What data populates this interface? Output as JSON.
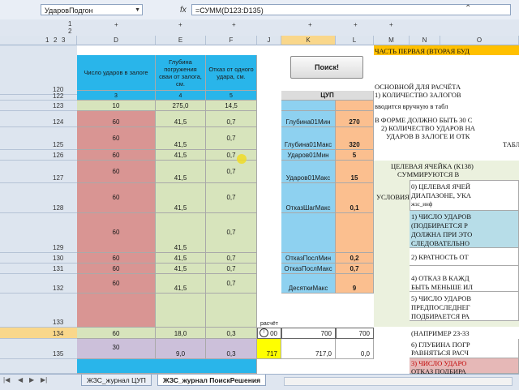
{
  "formula_bar": {
    "name_box": "УдаровПодгон",
    "fx": "fx",
    "formula": "=СУММ(D123:D135)"
  },
  "outline": {
    "levels": [
      "1",
      "2"
    ],
    "markers": [
      "+",
      "+",
      "+",
      "+",
      "+",
      "+"
    ],
    "left_row": [
      "1",
      "2",
      "3"
    ]
  },
  "columns": [
    "D",
    "E",
    "F",
    "J",
    "K",
    "L",
    "M",
    "N",
    "O"
  ],
  "rows": {
    "r120": "120",
    "r121": "121",
    "r122": "122",
    "r123": "123",
    "r124": "124",
    "r125": "125",
    "r126": "126",
    "r127": "127",
    "r128": "128",
    "r129": "129",
    "r130": "130",
    "r131": "131",
    "r132": "132",
    "r133": "133",
    "r134": "134",
    "r135": "135"
  },
  "headers": {
    "d": "Число ударов в залоге",
    "e": "Глубина погружения сваи от залога, см.",
    "f": "Отказ от одного удара, см.",
    "d_num": "3",
    "e_num": "4",
    "f_num": "5"
  },
  "search_button": "Поиск!",
  "cup_title": "ЦУП",
  "data": {
    "r123": {
      "d": "10",
      "e": "275,0",
      "f": "14,5"
    },
    "r124": {
      "d": "60",
      "e": "41,5",
      "f": "0,7"
    },
    "r125": {
      "d": "60",
      "e": "41,5",
      "f": "0,7"
    },
    "r126": {
      "d": "60",
      "e": "41,5",
      "f": "0,7"
    },
    "r127": {
      "d": "60",
      "e": "41,5",
      "f": "0,7"
    },
    "r128": {
      "d": "60",
      "e": "41,5",
      "f": "0,7"
    },
    "r129": {
      "d": "60",
      "e": "41,5",
      "f": "0,7"
    },
    "r130": {
      "d": "60",
      "e": "41,5",
      "f": "0,7"
    },
    "r131": {
      "d": "60",
      "e": "41,5",
      "f": "0,7"
    },
    "r132": {
      "d": "60",
      "e": "41,5",
      "f": "0,7"
    },
    "r134": {
      "d": "60",
      "e": "18,0",
      "f": "0,3"
    },
    "r135": {
      "d": "30",
      "e": "9,0",
      "f": "0,3"
    }
  },
  "params": [
    {
      "label": "Глубина01Мин",
      "value": "270"
    },
    {
      "label": "Глубина01Макс",
      "value": "320"
    },
    {
      "label": "Ударов01Мин",
      "value": "5"
    },
    {
      "label": "Ударов01Макс",
      "value": "15"
    },
    {
      "label": "ОтказШагМакс",
      "value": "0,1"
    },
    {
      "label": "ОтказПослМин",
      "value": "0,2"
    },
    {
      "label": "ОтказПослМакс",
      "value": "0,7"
    },
    {
      "label": "ДесяткиМакс",
      "value": "9"
    }
  ],
  "calc": {
    "raschet": "расчёт",
    "j134": "00",
    "k134": "700",
    "l134": "700",
    "j135": "717",
    "k135": "717,0",
    "l135": "0,0"
  },
  "notes": {
    "part": "ЧАСТЬ ПЕРВАЯ (ВТОРАЯ БУД",
    "basis": "ОСНОВНОЙ ДЛЯ РАСЧЁТА",
    "item1": "1) КОЛИЧЕСТВО ЗАЛОГОВ",
    "manual": "вводится вручную в табл",
    "form": "В ФОРМЕ ДОЛЖНО БЫТЬ 30 С",
    "item2": "2) КОЛИЧЕСТВО УДАРОВ НА",
    "item2b": "УДАРОВ В ЗАЛОГЕ И ОТК",
    "item2c": "ТАБЛ",
    "target": "ЦЕЛЕВАЯ ЯЧЕЙКА (К138)",
    "sum": "СУММИРУЮТСЯ В",
    "conditions": "УСЛОВИЯ",
    "c0a": "0) ЦЕЛЕВАЯ ЯЧЕЙ",
    "c0b": "ДИАПАЗОНЕ, УКА",
    "c0c": "жзс_инф",
    "c1a": "1) ЧИСЛО УДАРОВ",
    "c1b": "(ПОДБИРАЕТСЯ Р",
    "c1c": "ДОЛЖНА ПРИ ЭТО",
    "c1d": "СЛЕДОВАТЕЛЬНО",
    "c2": "2) КРАТНОСТЬ ОТ",
    "c4a": "4) ОТКАЗ В КАЖД",
    "c4b": "БЫТЬ МЕНЬШЕ ИЛ",
    "c5a": "5) ЧИСЛО УДАРОВ",
    "c5b": "ПРЕДПОСЛЕДНЕГ",
    "c5c": "ПОДБИРАЕТСЯ РА",
    "example": "(НАПРИМЕР 23-33",
    "c6a": "6) ГЛУБИНА ПОГР",
    "c6b": "РАВНЯТЬСЯ РАСЧ",
    "c3a": "3) ЧИСЛО УДАРО",
    "c3b": "ОТКАЗ ПОДБИРА"
  },
  "tabs": [
    {
      "label": "ЖЗС_журнал ЦУП"
    },
    {
      "label": "ЖЗС_журнал ПоискРешения"
    }
  ],
  "colors": {
    "header_blue": "#29b5ea",
    "rose": "#d99593",
    "green": "#d7e4bc",
    "orange": "#fbbf8f",
    "param_blue": "#8ed1f0",
    "lavender": "#ccc0da",
    "highlight": "#ffff00"
  }
}
